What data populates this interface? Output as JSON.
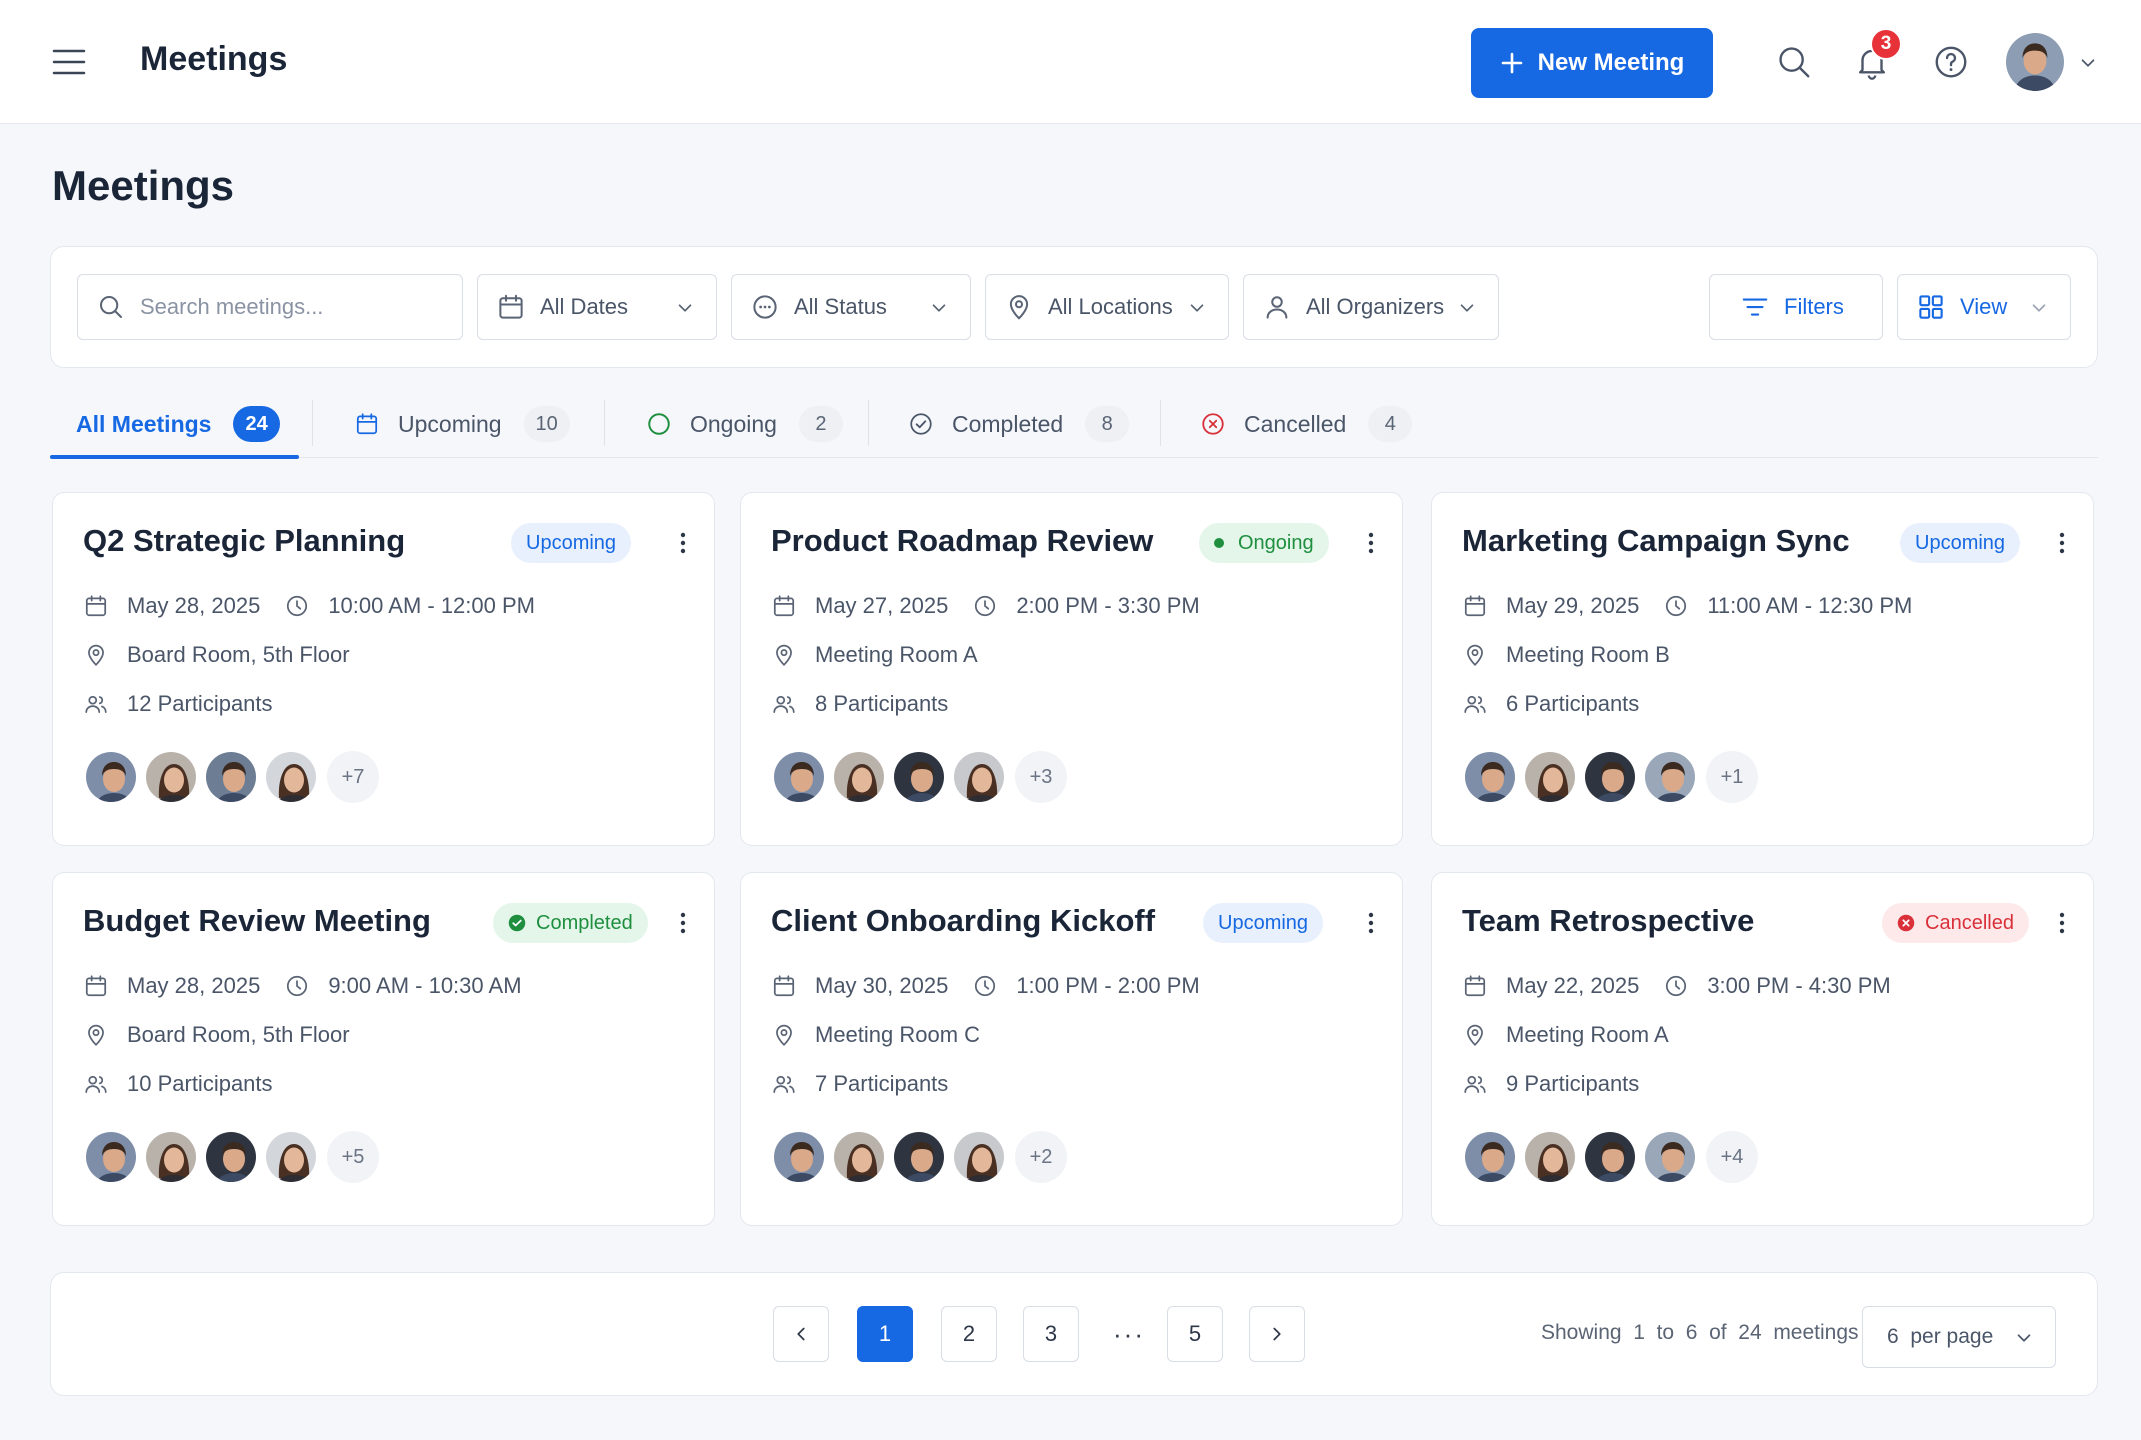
{
  "app": {
    "title": "Meetings",
    "new_meeting_label": "New Meeting",
    "notification_count": "3"
  },
  "page": {
    "title": "Meetings"
  },
  "filters": {
    "search_placeholder": "Search meetings...",
    "dates": "All Dates",
    "status": "All Status",
    "locations": "All Locations",
    "organizers": "All Organizers",
    "filters_label": "Filters",
    "view_label": "View"
  },
  "tabs": [
    {
      "label": "All Meetings",
      "count": "24"
    },
    {
      "label": "Upcoming",
      "count": "10"
    },
    {
      "label": "Ongoing",
      "count": "2"
    },
    {
      "label": "Completed",
      "count": "8"
    },
    {
      "label": "Cancelled",
      "count": "4"
    }
  ],
  "cards": [
    {
      "title": "Q2 Strategic Planning",
      "status": "Upcoming",
      "date": "May 28, 2025",
      "time": "10:00 AM - 12:00 PM",
      "location": "Board Room, 5th Floor",
      "participants": "12 Participants",
      "more": "+7"
    },
    {
      "title": "Product Roadmap Review",
      "status": "Ongoing",
      "date": "May 27, 2025",
      "time": "2:00 PM - 3:30 PM",
      "location": "Meeting Room A",
      "participants": "8 Participants",
      "more": "+3"
    },
    {
      "title": "Marketing Campaign Sync",
      "status": "Upcoming",
      "date": "May 29, 2025",
      "time": "11:00 AM - 12:30 PM",
      "location": "Meeting Room B",
      "participants": "6 Participants",
      "more": "+1"
    },
    {
      "title": "Budget Review Meeting",
      "status": "Completed",
      "date": "May 28, 2025",
      "time": "9:00 AM - 10:30 AM",
      "location": "Board Room, 5th Floor",
      "participants": "10 Participants",
      "more": "+5"
    },
    {
      "title": "Client Onboarding Kickoff",
      "status": "Upcoming",
      "date": "May 30, 2025",
      "time": "1:00 PM - 2:00 PM",
      "location": "Meeting Room C",
      "participants": "7 Participants",
      "more": "+2"
    },
    {
      "title": "Team Retrospective",
      "status": "Cancelled",
      "date": "May 22, 2025",
      "time": "3:00 PM - 4:30 PM",
      "location": "Meeting Room A",
      "participants": "9 Participants",
      "more": "+4"
    }
  ],
  "pagination": {
    "pages": [
      "1",
      "2",
      "3",
      "5"
    ],
    "ellipsis": "···",
    "current_page": "1",
    "showing": "Showing  1  to  6  of  24  meetings",
    "per_page": "6  per page"
  },
  "colors": {
    "accent": "#1668e3",
    "success": "#1f8f3f",
    "danger": "#d9303a"
  },
  "icons": [
    "menu-icon",
    "plus-icon",
    "search-icon",
    "bell-icon",
    "help-icon",
    "chevron-down-icon",
    "calendar-icon",
    "status-icon",
    "location-icon",
    "person-icon",
    "filter-icon",
    "grid-view-icon",
    "clock-icon",
    "participants-icon",
    "kebab-icon",
    "check-circle-icon",
    "x-circle-icon",
    "chevron-left-icon",
    "chevron-right-icon"
  ]
}
